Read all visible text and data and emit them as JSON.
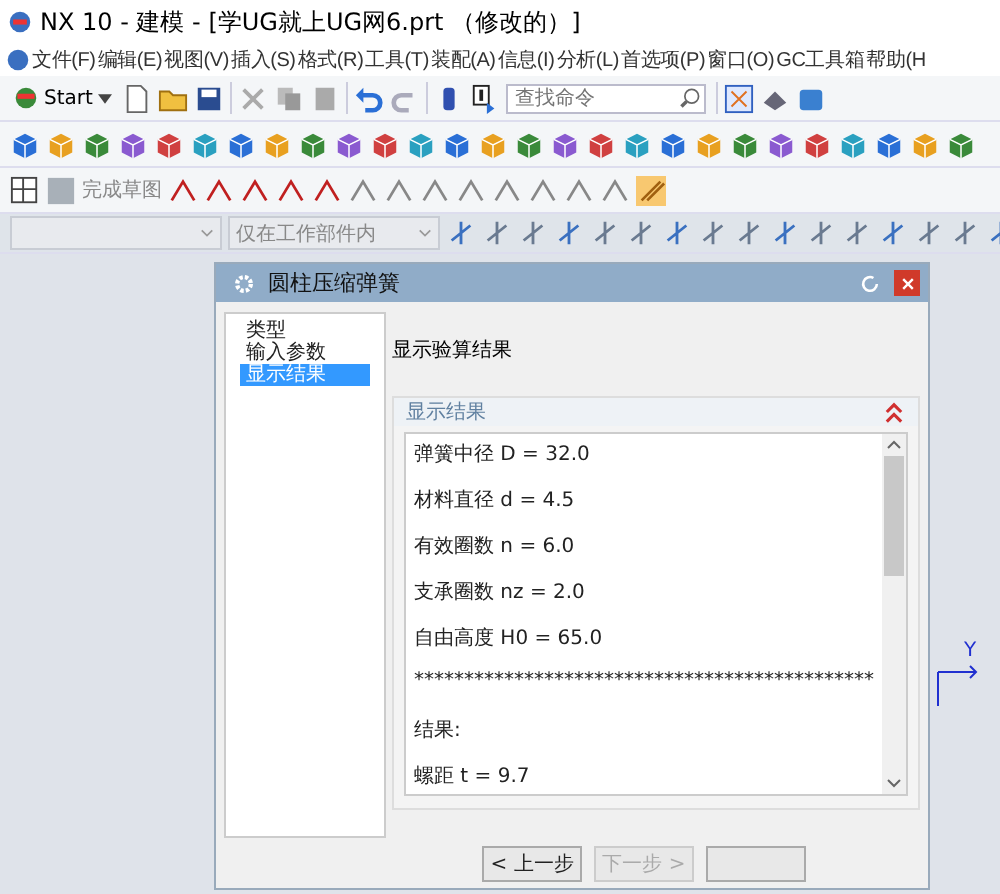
{
  "window": {
    "title": "NX 10 - 建模 - [学UG就上UG网6.prt （修改的）]"
  },
  "menu": [
    "文件(F)",
    "编辑(E)",
    "视图(V)",
    "插入(S)",
    "格式(R)",
    "工具(T)",
    "装配(A)",
    "信息(I)",
    "分析(L)",
    "首选项(P)",
    "窗口(O)",
    "GC工具箱",
    "帮助(H"
  ],
  "toolbar": {
    "start_label": "Start",
    "search": {
      "placeholder": "查找命令"
    }
  },
  "sketch_toolbar": {
    "finish_label": "完成草图"
  },
  "selection_bar": {
    "filter_2": "仅在工作部件内"
  },
  "triad": {
    "axis_label": "Y"
  },
  "dialog": {
    "title": "圆柱压缩弹簧",
    "steps": [
      {
        "label": "类型",
        "selected": false
      },
      {
        "label": "输入参数",
        "selected": false
      },
      {
        "label": "显示结果",
        "selected": true
      }
    ],
    "heading": "显示验算结果",
    "section": {
      "title": "显示结果",
      "expanded": true,
      "lines": [
        "弹簧中径 D = 32.0",
        "材料直径 d = 4.5",
        "有效圈数 n = 6.0",
        "支承圈数 nz = 2.0",
        "自由高度 H0 = 65.0",
        "**********************************************",
        "结果:",
        "螺距 t = 9.7"
      ]
    },
    "buttons": [
      {
        "label": "< 上一步",
        "disabled": false
      },
      {
        "label": "下一步 >",
        "disabled": true
      },
      {
        "disabled": false
      }
    ]
  }
}
